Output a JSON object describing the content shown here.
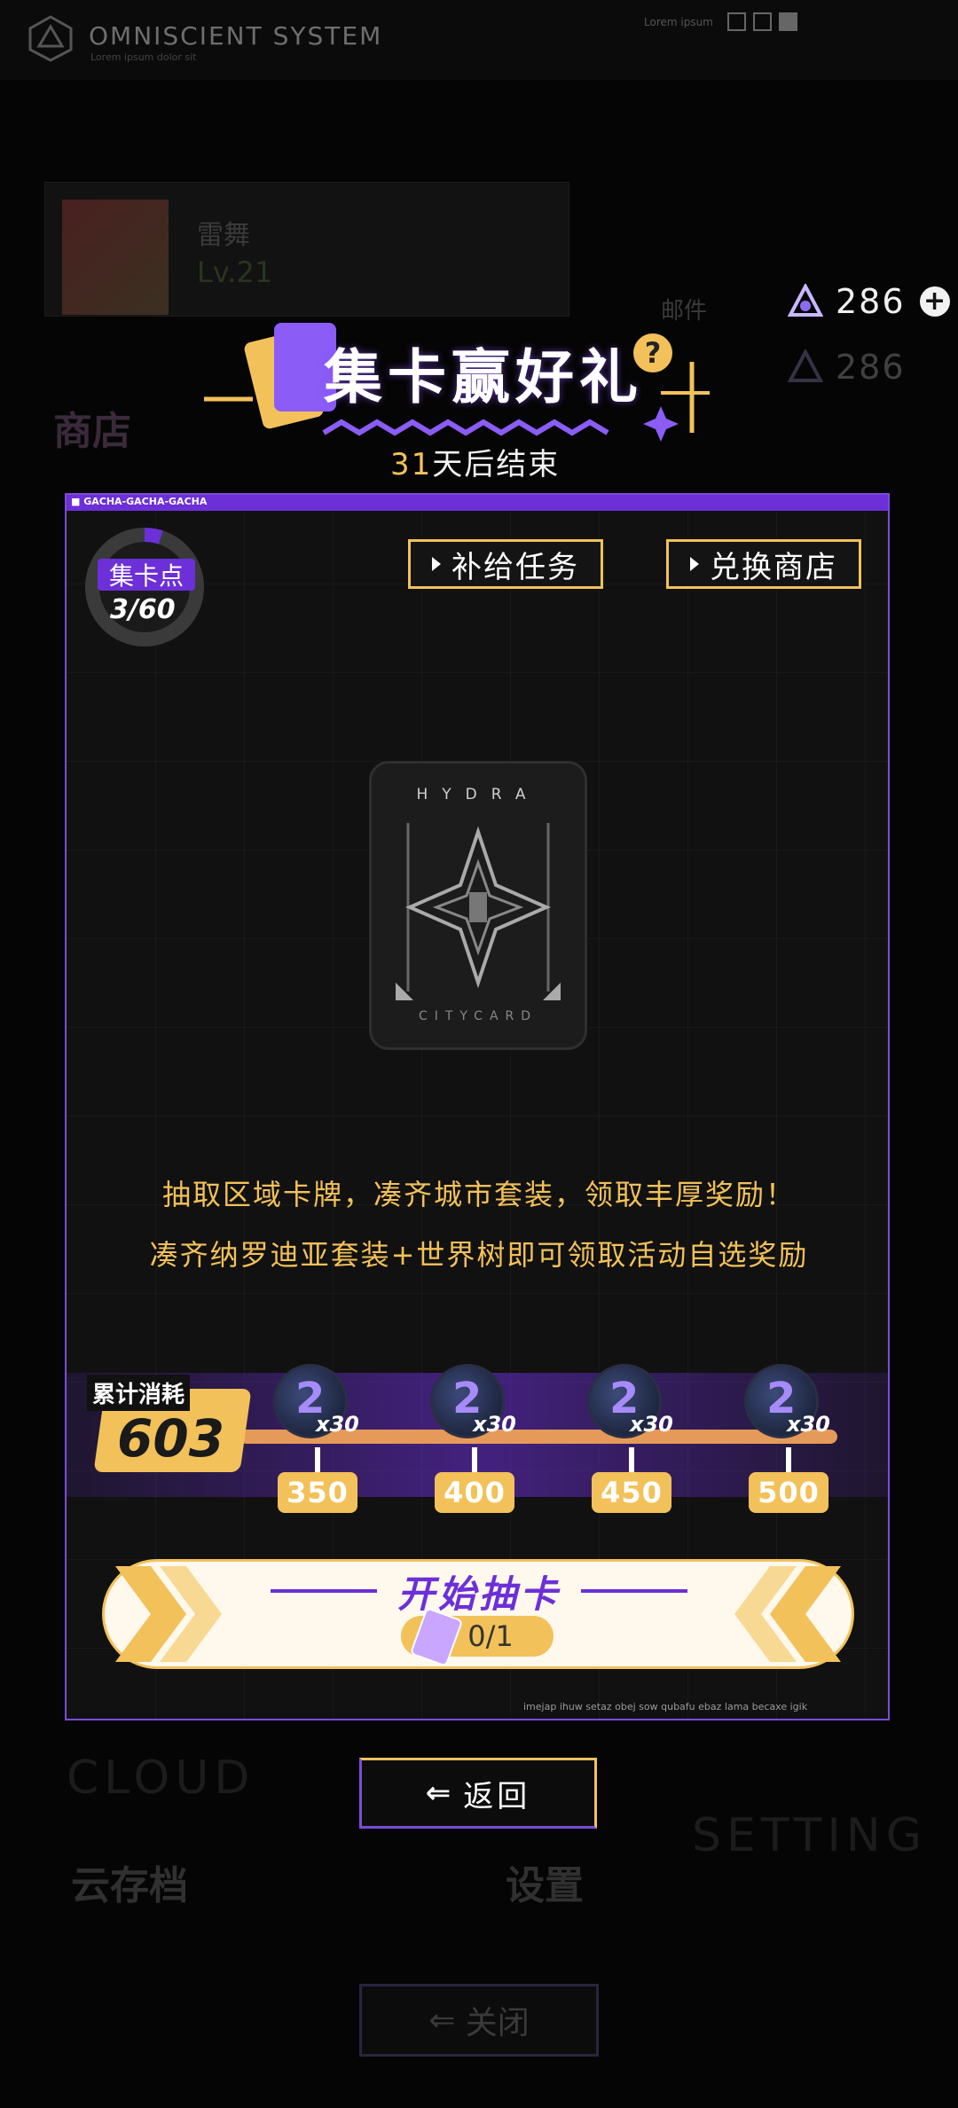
{
  "background": {
    "system_title": "OMNISCIENT SYSTEM",
    "system_subtitle": "Lorem ipsum dolor sit",
    "top_lorem": "Lorem ipsum",
    "profile_name": "雷舞",
    "profile_level": "Lv.21",
    "shop_label": "商店",
    "mail_label": "邮件",
    "cloud_en": "CLOUD",
    "cloud_save_label": "云存档",
    "setting_en": "SETTING",
    "settings_label": "设置",
    "close_label": "关闭"
  },
  "currency": {
    "value": "286",
    "icon": "gem-icon",
    "add_icon": "plus-icon"
  },
  "event": {
    "title": "集卡赢好礼",
    "days_left": "31",
    "days_suffix": "天后结束",
    "help_icon": "question-icon"
  },
  "panel": {
    "header": "GACHA-GACHA-GACHA",
    "footer": "imejap ihuw setaz obej sow qubafu ebaz lama becaxe igik",
    "points": {
      "label": "集卡点",
      "value": "3/60",
      "progress": 0.05
    },
    "buttons": {
      "supply_task": "补给任务",
      "exchange_shop": "兑换商店"
    },
    "card": {
      "top_text": "HYDRA",
      "bottom_text": "CITYCARD"
    },
    "description": [
      "抽取区域卡牌，凑齐城市套装，领取丰厚奖励！",
      "凑齐纳罗迪亚套装+世界树即可领取活动自选奖励"
    ],
    "cumulative": {
      "label": "累计消耗",
      "value": "603"
    },
    "rewards": [
      {
        "threshold": "350",
        "quantity": "x30",
        "icon": "coin-icon"
      },
      {
        "threshold": "400",
        "quantity": "x30",
        "icon": "coin-icon"
      },
      {
        "threshold": "450",
        "quantity": "x30",
        "icon": "coin-icon"
      },
      {
        "threshold": "500",
        "quantity": "x30",
        "icon": "coin-icon"
      }
    ],
    "draw": {
      "label": "开始抽卡",
      "count": "0/1",
      "ticket_icon": "ticket-icon"
    }
  },
  "back_button": {
    "label": "返回",
    "icon": "back-icon"
  },
  "colors": {
    "accent_purple": "#6c2fd8",
    "accent_gold": "#f3c15a",
    "track_orange": "#e59a5a"
  }
}
